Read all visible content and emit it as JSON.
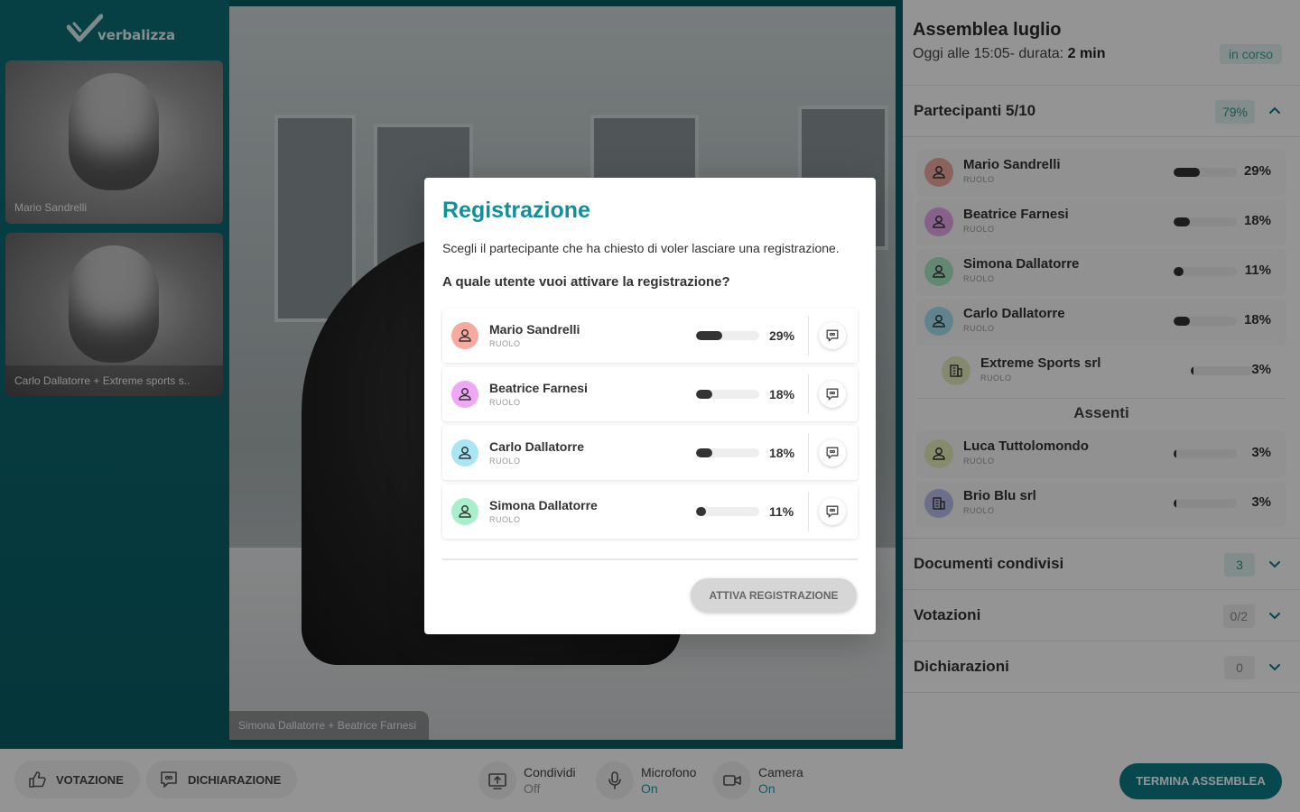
{
  "app": {
    "logo_text": "verbalizza"
  },
  "tiles": [
    {
      "label": "Mario Sandrelli"
    },
    {
      "label": "Carlo Dallatorre + Extreme sports s.."
    }
  ],
  "main_video": {
    "label": "Simona Dallatorre + Beatrice Farnesi"
  },
  "sidebar": {
    "title": "Assemblea luglio",
    "subtitle_prefix": "Oggi alle 15:05- durata:",
    "duration": "2 min",
    "status": "in corso",
    "participants": {
      "title": "Partecipanti 5/10",
      "badge": "79%",
      "present": [
        {
          "name": "Mario Sandrelli",
          "role": "RUOLO",
          "pct": "29%",
          "value": 29,
          "avatar_color": "#f2a9a0",
          "icon": "user-icon"
        },
        {
          "name": "Beatrice Farnesi",
          "role": "RUOLO",
          "pct": "18%",
          "value": 18,
          "avatar_color": "#e8a8ec",
          "icon": "user-icon"
        },
        {
          "name": "Simona Dallatorre",
          "role": "RUOLO",
          "pct": "11%",
          "value": 11,
          "avatar_color": "#a9e9c6",
          "icon": "user-icon"
        },
        {
          "name": "Carlo Dallatorre",
          "role": "RUOLO",
          "pct": "18%",
          "value": 18,
          "avatar_color": "#a6e2f3",
          "icon": "user-icon"
        },
        {
          "name": "Extreme Sports srl",
          "role": "RUOLO",
          "pct": "3%",
          "value": 3,
          "avatar_color": "#e5edbd",
          "icon": "building-icon"
        }
      ],
      "absent_title": "Assenti",
      "absent": [
        {
          "name": "Luca Tuttolomondo",
          "role": "RUOLO",
          "pct": "3%",
          "value": 3,
          "avatar_color": "#e7efb8",
          "icon": "user-icon"
        },
        {
          "name": "Brio Blu srl",
          "role": "RUOLO",
          "pct": "3%",
          "value": 3,
          "avatar_color": "#b8c0ec",
          "icon": "building-icon"
        }
      ]
    },
    "documents": {
      "title": "Documenti condivisi",
      "badge": "3"
    },
    "votes": {
      "title": "Votazioni",
      "badge": "0/2"
    },
    "declarations": {
      "title": "Dichiarazioni",
      "badge": "0"
    }
  },
  "bottombar": {
    "vote_label": "VOTAZIONE",
    "declaration_label": "DICHIARAZIONE",
    "share_label": "Condividi",
    "share_state": "Off",
    "mic_label": "Microfono",
    "mic_state": "On",
    "camera_label": "Camera",
    "camera_state": "On",
    "end_label": "TERMINA ASSEMBLEA"
  },
  "modal": {
    "title": "Registrazione",
    "description": "Scegli il partecipante che ha chiesto di voler lasciare una registrazione.",
    "question": "A quale utente vuoi attivare la registrazione?",
    "users": [
      {
        "name": "Mario Sandrelli",
        "role": "RUOLO",
        "pct": "29%",
        "value": 29,
        "avatar_color": "#f8a9a0"
      },
      {
        "name": "Beatrice Farnesi",
        "role": "RUOLO",
        "pct": "18%",
        "value": 18,
        "avatar_color": "#eea8f5"
      },
      {
        "name": "Carlo Dallatorre",
        "role": "RUOLO",
        "pct": "18%",
        "value": 18,
        "avatar_color": "#a8e6f6"
      },
      {
        "name": "Simona Dallatorre",
        "role": "RUOLO",
        "pct": "11%",
        "value": 11,
        "avatar_color": "#a8f0cc"
      }
    ],
    "button_label": "ATTIVA REGISTRAZIONE"
  },
  "colors": {
    "accent": "#12909a",
    "end_button": "#0c7c86",
    "state_on": "#1d9fa8",
    "state_off": "#999999"
  }
}
